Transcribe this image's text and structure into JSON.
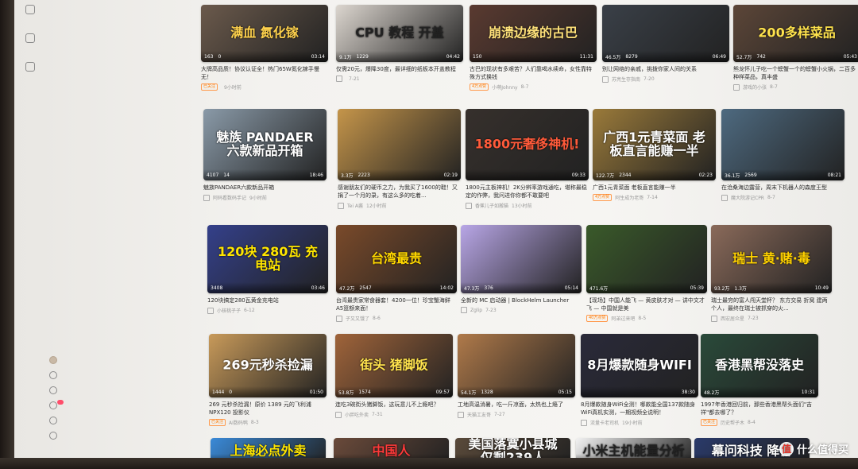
{
  "cards": [
    {
      "title": "大牌高品质！协议认证全！热门65W氮化镓手慢无！",
      "views": "163",
      "dm": "0",
      "dur": "03:14",
      "tag": "已关注",
      "uploader": "",
      "date": "9小时前",
      "big": "满血 氮化镓",
      "thumbColor": "#6b5a4c",
      "bigColor": "#ffd24d"
    },
    {
      "title": "仅需20元，爆降30度，最详细的纸板本开盖教程",
      "views": "9.1万",
      "dm": "1229",
      "dur": "04:42",
      "tag": "",
      "uploader": "",
      "date": "7-21",
      "big": "CPU 教程 开盖",
      "thumbColor": "#dcd6cf",
      "bigColor": "#222222"
    },
    {
      "title": "古巴的现状有多艰苦？人们靠喝水续命，女性靠特殊方式换钱",
      "views": "150",
      "dm": "",
      "dur": "11:31",
      "tag": "4万点赞",
      "uploader": "小萌Johnny",
      "date": "8-7",
      "big": "崩溃边缘的古巴",
      "thumbColor": "#5a3a30",
      "bigColor": "#ffe27a"
    },
    {
      "title": "别让网络的亲戚，挑拨你家人间的关系",
      "views": "46.5万",
      "dm": "8279",
      "dur": "06:49",
      "tag": "",
      "uploader": "苏亮生存指南",
      "date": "7-20",
      "big": "",
      "thumbColor": "#3a4048",
      "bigColor": "#ffffff"
    },
    {
      "title": "熊龙怀儿子吃一个螃蟹一个的螃蟹小火锅，二百多种样菜品，真丰盛",
      "views": "52.7万",
      "dm": "742",
      "dur": "05:43",
      "tag": "",
      "uploader": "游戏的小张",
      "date": "8-7",
      "big": "200多样菜品",
      "thumbColor": "#5c4638",
      "bigColor": "#ffe34d"
    },
    {
      "title": "魅族PANDAER六款新品开箱",
      "views": "4107",
      "dm": "14",
      "dur": "18:46",
      "tag": "",
      "uploader": "阿码看数码手记",
      "date": "9小时前",
      "big": "魅族 PANDAER 六款新品开箱",
      "thumbColor": "#8a9aa8",
      "bigColor": "#ffffff"
    },
    {
      "title": "感谢朋友们的硬币之力，为我买了1600的鞋！又捐了一个月的录，有这么多的吃着...",
      "views": "3.3万",
      "dm": "2223",
      "dur": "02:19",
      "tag": "",
      "uploader": "Tei A酱",
      "date": "12小时前",
      "big": "",
      "thumbColor": "#c5954a",
      "bigColor": "#ffffff"
    },
    {
      "title": "1800元主板神机！2K分辨率游戏通吃，堪称最稳定的作弊，我问进你你都不敢要吧",
      "views": "",
      "dm": "",
      "dur": "09:33",
      "tag": "",
      "uploader": "香蕉儿子如搬猫",
      "date": "13小时前",
      "big": "1800元奢侈神机!",
      "thumbColor": "#36302c",
      "bigColor": "#ff5a3a"
    },
    {
      "title": "广西1元青菜面 老板直言能赚一半",
      "views": "122.7万",
      "dm": "2344",
      "dur": "02:23",
      "tag": "4万点赞",
      "uploader": "阿生成为老哥",
      "date": "7-14",
      "big": "广西1元青菜面 老板直言能赚一半",
      "thumbColor": "#9a7a3a",
      "bigColor": "#ffffff"
    },
    {
      "title": "在沧桑海边露营，周末下机器人的森度王型",
      "views": "36.1万",
      "dm": "2569",
      "dur": "08:21",
      "tag": "",
      "uploader": "魔大院游记CPR",
      "date": "8-7",
      "big": "",
      "thumbColor": "#4e6a80",
      "bigColor": "#ffffff"
    },
    {
      "title": "120块搞定280瓦黄金充电站",
      "views": "3408",
      "dm": "",
      "dur": "03:46",
      "tag": "",
      "uploader": "小核桃子子",
      "date": "6-12",
      "big": "120块 280瓦 充电站",
      "thumbColor": "#34408a",
      "bigColor": "#ffe600"
    },
    {
      "title": "台湾最贵家常食器套！4200一位！珍宝蟹海鲜A5篮额来面！",
      "views": "47.2万",
      "dm": "2547",
      "dur": "14:02",
      "tag": "",
      "uploader": "子又又饿了",
      "date": "8-6",
      "big": "台湾最贵",
      "thumbColor": "#7a4a2a",
      "bigColor": "#ffd700"
    },
    {
      "title": "全新的 MC 启动器 | BlockHelm Launcher",
      "views": "47.3万",
      "dm": "376",
      "dur": "05:14",
      "tag": "",
      "uploader": "Zglip",
      "date": "7-23",
      "big": "",
      "thumbColor": "#b8a6e6",
      "bigColor": "#ffffff"
    },
    {
      "title": "【现场】中国人能飞 — 黄皮肤才对 — 讲中文才飞 — 中国就是美",
      "views": "471.6万",
      "dm": "",
      "dur": "05:39",
      "tag": "40万点赞",
      "uploader": "阿弟过来吧",
      "date": "8-5",
      "big": "",
      "thumbColor": "#3a5a2a",
      "bigColor": "#ffffff"
    },
    {
      "title": "瑞士最穷的富人闯天堂杯？ 东方交易 折窝 建两个人，最终在瑞士被抓穿的火...",
      "views": "93.2万",
      "dm": "1.3万",
      "dur": "10:49",
      "tag": "",
      "uploader": "西宏居众星",
      "date": "7-23",
      "big": "瑞士 黄·赌·毒",
      "thumbColor": "#8a6a5a",
      "bigColor": "#ffd200"
    },
    {
      "title": "269 元秒杀捡漏！原价 1389 元的飞利浦NPX120 投影仪",
      "views": "1444",
      "dm": "0",
      "dur": "01:50",
      "tag": "已关注",
      "uploader": "AI数码鸭",
      "date": "8-3",
      "big": "269元秒杀捡漏",
      "thumbColor": "#c89a5a",
      "bigColor": "#ffffff"
    },
    {
      "title": "连吃3碗街头猪脚饭，这玩意儿不上瘾吧？",
      "views": "53.8万",
      "dm": "1574",
      "dur": "09:57",
      "tag": "",
      "uploader": "小胖吃外卖",
      "date": "7-31",
      "big": "街头 猪脚饭",
      "thumbColor": "#a0643a",
      "bigColor": "#ffe34d"
    },
    {
      "title": "工地高温消暑，吃一斤凉面，太热也上瘾了",
      "views": "54.1万",
      "dm": "1328",
      "dur": "05:15",
      "tag": "",
      "uploader": "天猫工友哥",
      "date": "7-27",
      "big": "",
      "thumbColor": "#b07a4a",
      "bigColor": "#ffffff"
    },
    {
      "title": "8月爆款随身WiFi全测！哪款能全国137款随身WiFi真机实测，一期视频全说明！",
      "views": "",
      "dm": "",
      "dur": "38:30",
      "tag": "",
      "uploader": "流量卡老司机",
      "date": "19小时前",
      "big": "8月爆款随身WIFI",
      "thumbColor": "#2a2a3a",
      "bigColor": "#ffffff"
    },
    {
      "title": "1997年香港回归前，那些香港黑帮头面们\"吉祥\"都去哪了？",
      "views": "48.2万",
      "dm": "",
      "dur": "10:31",
      "tag": "已关注",
      "uploader": "历史帮子木",
      "date": "8-4",
      "big": "香港黑帮没落史",
      "thumbColor": "#2a4a3a",
      "bigColor": "#ffffff"
    },
    {
      "title": "",
      "views": "",
      "dm": "",
      "dur": "",
      "tag": "",
      "uploader": "",
      "date": "",
      "big": "上海必点外卖",
      "thumbColor": "#3a8ad8",
      "bigColor": "#ffe600"
    },
    {
      "title": "",
      "views": "",
      "dm": "",
      "dur": "",
      "tag": "",
      "uploader": "",
      "date": "",
      "big": "中国人",
      "thumbColor": "#6a4a3a",
      "bigColor": "#ff3a3a"
    },
    {
      "title": "",
      "views": "",
      "dm": "",
      "dur": "",
      "tag": "",
      "uploader": "",
      "date": "",
      "big": "美国落寞小县城 仅剩239人",
      "thumbColor": "#5a4a3a",
      "bigColor": "#ffffff"
    },
    {
      "title": "",
      "views": "",
      "dm": "",
      "dur": "",
      "tag": "",
      "uploader": "",
      "date": "",
      "big": "小米主机能量分析",
      "thumbColor": "#f2f2f2",
      "bigColor": "#222222"
    },
    {
      "title": "",
      "views": "",
      "dm": "",
      "dur": "",
      "tag": "",
      "uploader": "",
      "date": "",
      "big": "幕问科技 降价",
      "thumbColor": "#2a3a6a",
      "bigColor": "#ffffff"
    }
  ],
  "watermark": {
    "logo": "值",
    "text": "什么值得买"
  }
}
